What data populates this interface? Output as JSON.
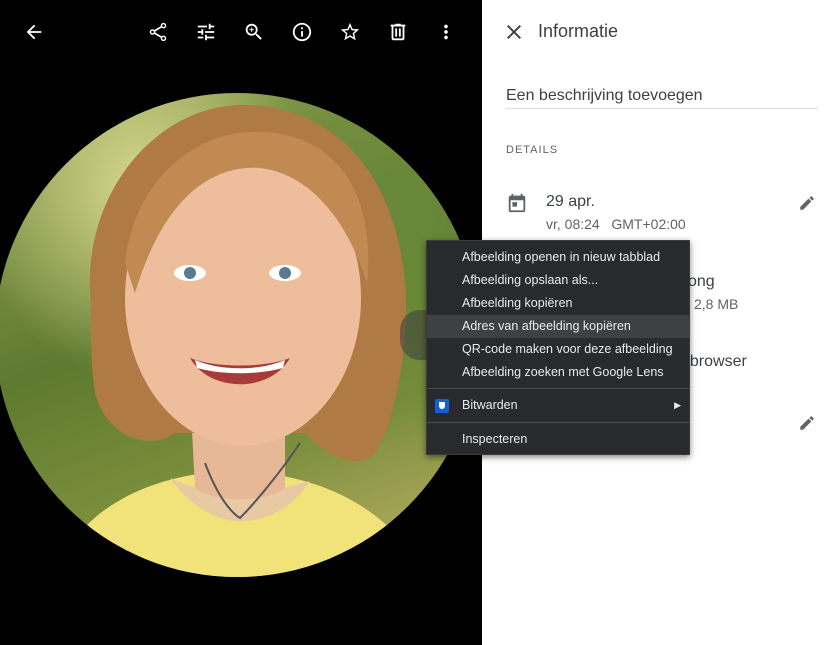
{
  "viewer": {
    "toolbar": {
      "back": "arrow-back-icon",
      "share": "share-icon",
      "edit": "tune-icon",
      "zoom": "zoom-in-icon",
      "info": "info-icon",
      "favorite": "star-icon",
      "delete": "trash-icon",
      "more": "more-vert-icon"
    },
    "photo_alt": "portret-foto"
  },
  "panel": {
    "title": "Informatie",
    "description_placeholder": "Een beschrijving toevoegen",
    "details_heading": "DETAILS",
    "date": "29 apr.",
    "date_sub": "vr, 08:24   GMT+02:00",
    "partial_line1": "ong",
    "partial_line2": "2,8 MB",
    "partial_line3": "bbrowser"
  },
  "context_menu": {
    "items": [
      "Afbeelding openen in nieuw tabblad",
      "Afbeelding opslaan als...",
      "Afbeelding kopiëren",
      "Adres van afbeelding kopiëren",
      "QR-code maken voor deze afbeelding",
      "Afbeelding zoeken met Google Lens"
    ],
    "extension": "Bitwarden",
    "inspect": "Inspecteren"
  },
  "colors": {
    "menu_bg": "#292a2d",
    "menu_highlight": "#3f4042",
    "bitwarden_blue": "#175ddc"
  }
}
